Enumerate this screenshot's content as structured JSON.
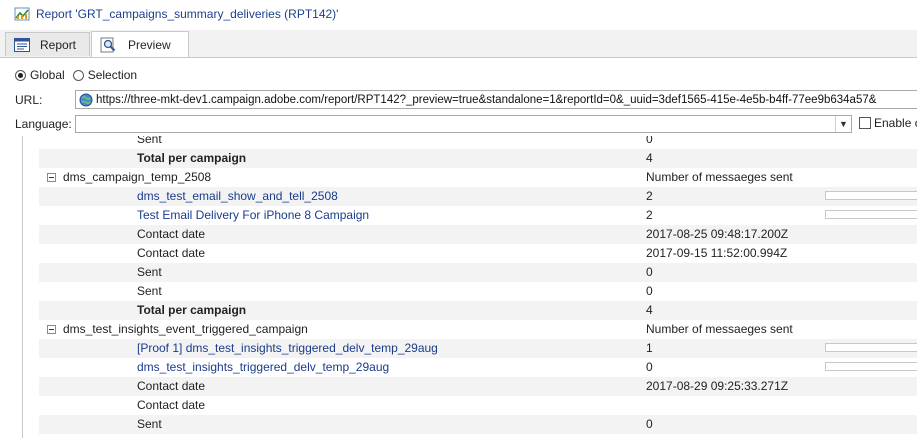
{
  "window": {
    "title": "Report 'GRT_campaigns_summary_deliveries (RPT142)'"
  },
  "tabs": [
    {
      "label": "Report",
      "icon": "report-form-icon",
      "active": false
    },
    {
      "label": "Preview",
      "icon": "magnifier-icon",
      "active": true
    }
  ],
  "scope": {
    "options": [
      {
        "label": "Global",
        "selected": true
      },
      {
        "label": "Selection",
        "selected": false
      }
    ]
  },
  "url": {
    "label": "URL:",
    "value": "https://three-mkt-dev1.campaign.adobe.com/report/RPT142?_preview=true&standalone=1&reportId=0&_uuid=3def1565-415e-4e5b-b4ff-77ee9b634a57&"
  },
  "language": {
    "label": "Language:",
    "value": "",
    "enable_label": "Enable c"
  },
  "report": {
    "rows": [
      {
        "kind": "detail",
        "label": "Sent",
        "value": "0",
        "shade": false
      },
      {
        "kind": "total",
        "label": "Total per campaign",
        "value": "4",
        "shade": true
      },
      {
        "kind": "group",
        "label": "dms_campaign_temp_2508",
        "value": "Number of messaeges sent"
      },
      {
        "kind": "link",
        "label": "dms_test_email_show_and_tell_2508",
        "value": "2",
        "shade": true,
        "bar": 0
      },
      {
        "kind": "link",
        "label": "Test Email Delivery For iPhone 8 Campaign",
        "value": "2",
        "shade": false,
        "bar": 0
      },
      {
        "kind": "detail",
        "label": "Contact date",
        "value": "2017-08-25 09:48:17.200Z",
        "shade": true
      },
      {
        "kind": "detail",
        "label": "Contact date",
        "value": "2017-09-15 11:52:00.994Z",
        "shade": false
      },
      {
        "kind": "detail",
        "label": "Sent",
        "value": "0",
        "shade": true
      },
      {
        "kind": "detail",
        "label": "Sent",
        "value": "0",
        "shade": false
      },
      {
        "kind": "total",
        "label": "Total per campaign",
        "value": "4",
        "shade": true
      },
      {
        "kind": "group",
        "label": "dms_test_insights_event_triggered_campaign",
        "value": "Number of messaeges sent"
      },
      {
        "kind": "link",
        "label": "[Proof 1] dms_test_insights_triggered_delv_temp_29aug",
        "value": "1",
        "shade": true,
        "bar": 0
      },
      {
        "kind": "link",
        "label": "dms_test_insights_triggered_delv_temp_29aug",
        "value": "0",
        "shade": false,
        "bar": 0
      },
      {
        "kind": "detail",
        "label": "Contact date",
        "value": "2017-08-29 09:25:33.271Z",
        "shade": true
      },
      {
        "kind": "detail",
        "label": "Contact date",
        "value": "",
        "shade": false
      },
      {
        "kind": "detail",
        "label": "Sent",
        "value": "0",
        "shade": true
      }
    ]
  },
  "colors": {
    "link": "#1a3c8c",
    "title": "#1f3f8f",
    "row_shade": "#f3f3f3"
  }
}
